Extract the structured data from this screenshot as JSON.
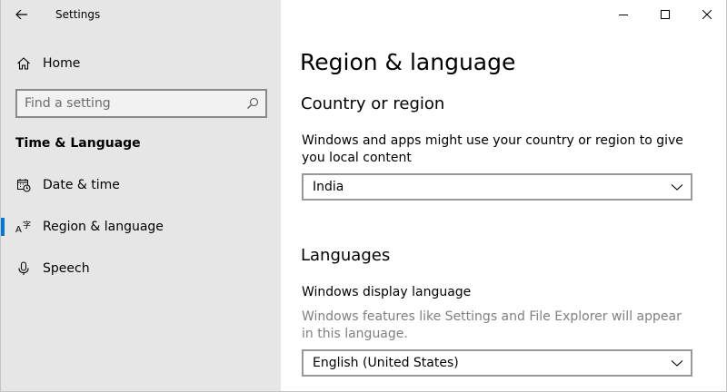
{
  "window": {
    "app_title": "Settings"
  },
  "sidebar": {
    "home_label": "Home",
    "search": {
      "placeholder": "Find a setting",
      "value": ""
    },
    "section_heading": "Time & Language",
    "items": [
      {
        "label": "Date & time",
        "icon": "calendar-clock-icon",
        "selected": false
      },
      {
        "label": "Region & language",
        "icon": "language-icon",
        "selected": true
      },
      {
        "label": "Speech",
        "icon": "microphone-icon",
        "selected": false
      }
    ]
  },
  "main": {
    "title": "Region & language",
    "country": {
      "heading": "Country or region",
      "description": "Windows and apps might use your country or region to give you local content",
      "selected": "India"
    },
    "languages": {
      "heading": "Languages",
      "display_label": "Windows display language",
      "display_description": "Windows features like Settings and File Explorer will appear in this language.",
      "display_selected": "English (United States)"
    }
  },
  "colors": {
    "accent": "#0078d7",
    "sidebar_bg": "#e6e6e6",
    "muted_text": "#808080"
  }
}
